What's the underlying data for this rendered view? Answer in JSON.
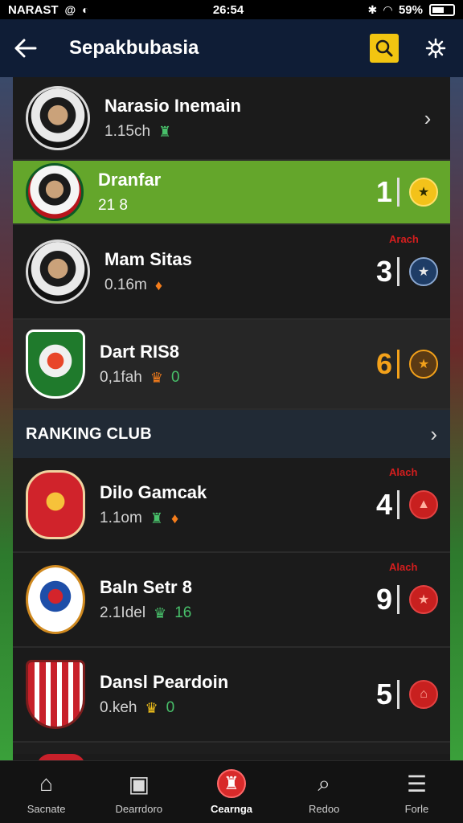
{
  "status_bar": {
    "left_text": "NARAST",
    "time": "26:54",
    "battery": "59%"
  },
  "header": {
    "title": "Sepakbubasia",
    "back_icon": "arrow-left-icon",
    "search_icon": "search-icon",
    "settings_icon": "gear-icon",
    "accent": "#f2c511"
  },
  "players": [
    {
      "name": "Narasio Inemain",
      "sub": "1.15ch",
      "rank": "",
      "tag": ""
    },
    {
      "name": "Dranfar",
      "sub": "21 8",
      "rank": "1",
      "tag": ""
    },
    {
      "name": "Mam Sitas",
      "sub": "0.16m",
      "rank": "3",
      "tag": "Arach"
    },
    {
      "name": "Dart RIS8",
      "sub": "0,1fah",
      "sub2": "0",
      "rank": "6",
      "tag": ""
    }
  ],
  "section": {
    "title": "RANKING CLUB"
  },
  "clubs": [
    {
      "name": "Dilo Gamcak",
      "sub": "1.1om",
      "rank": "4",
      "tag": "Alach"
    },
    {
      "name": "Baln Setr 8",
      "sub": "2.1Idel",
      "sub2": "16",
      "rank": "9",
      "tag": "Alach"
    },
    {
      "name": "Dansl Peardoin",
      "sub": "0.keh",
      "sub2": "0",
      "rank": "5",
      "tag": ""
    }
  ],
  "bottom_nav": [
    {
      "label": "Sacnate",
      "icon": "home-icon"
    },
    {
      "label": "Dearrdoro",
      "icon": "tv-icon"
    },
    {
      "label": "Cearnga",
      "icon": "trophy-icon",
      "active": true
    },
    {
      "label": "Redoo",
      "icon": "search-icon"
    },
    {
      "label": "Forle",
      "icon": "menu-icon"
    }
  ],
  "colors": {
    "selected_row": "#64a62b",
    "rank_gold": "#f3a11a",
    "tag_red": "#d41e1e"
  }
}
